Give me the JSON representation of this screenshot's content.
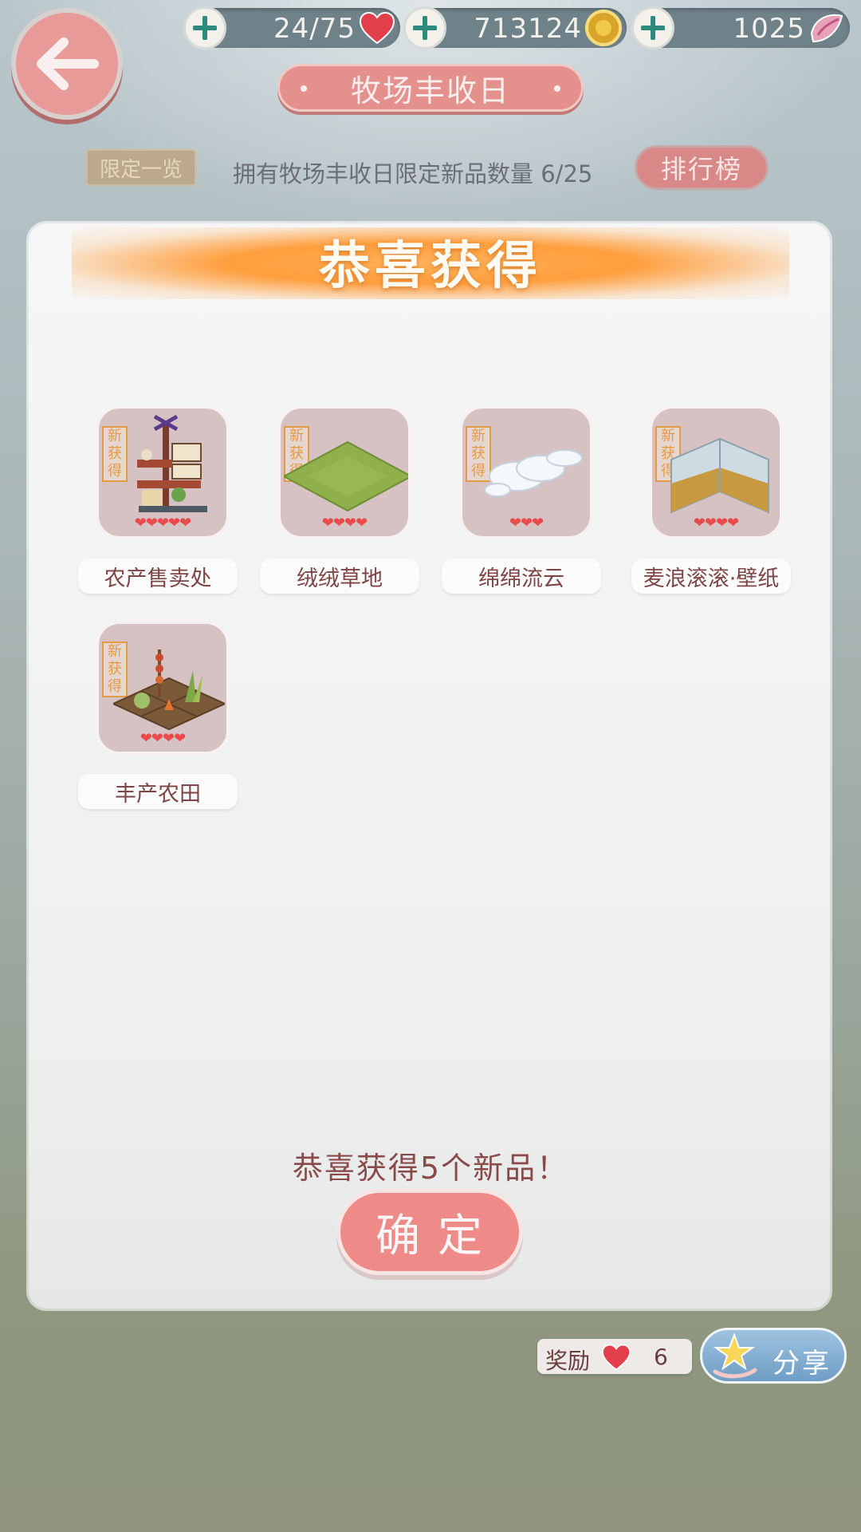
{
  "header": {
    "back": {
      "icon": "back-arrow-icon"
    },
    "resources": [
      {
        "name": "hearts",
        "value": "24/75",
        "icon": "heart-icon"
      },
      {
        "name": "coins",
        "value": "713124",
        "icon": "coin-icon"
      },
      {
        "name": "gems",
        "value": "1025",
        "icon": "gem-icon"
      }
    ],
    "title": "牧场丰收日"
  },
  "limited": {
    "tag": "限定一览",
    "text": "拥有牧场丰收日限定新品数量 6/25",
    "rank_button": "排行榜"
  },
  "modal": {
    "title": "恭喜获得",
    "items": [
      {
        "name": "农产售卖处",
        "new_tag": "新获得",
        "stars": "❤❤❤❤❤"
      },
      {
        "name": "绒绒草地",
        "new_tag": "新获得",
        "stars": "❤❤❤❤"
      },
      {
        "name": "绵绵流云",
        "new_tag": "新获得",
        "stars": "❤❤❤"
      },
      {
        "name": "麦浪滚滚·壁纸",
        "new_tag": "新获得",
        "stars": "❤❤❤❤"
      },
      {
        "name": "丰产农田",
        "new_tag": "新获得",
        "stars": "❤❤❤❤"
      }
    ],
    "congrats": "恭喜获得5个新品！",
    "confirm": "确定"
  },
  "footer": {
    "reward_label": "奖励",
    "reward_value": "6",
    "share": "分享"
  },
  "colors": {
    "accent": "#e89a98",
    "heart": "#e94a4a",
    "ribbon": "#ff9e3d"
  }
}
